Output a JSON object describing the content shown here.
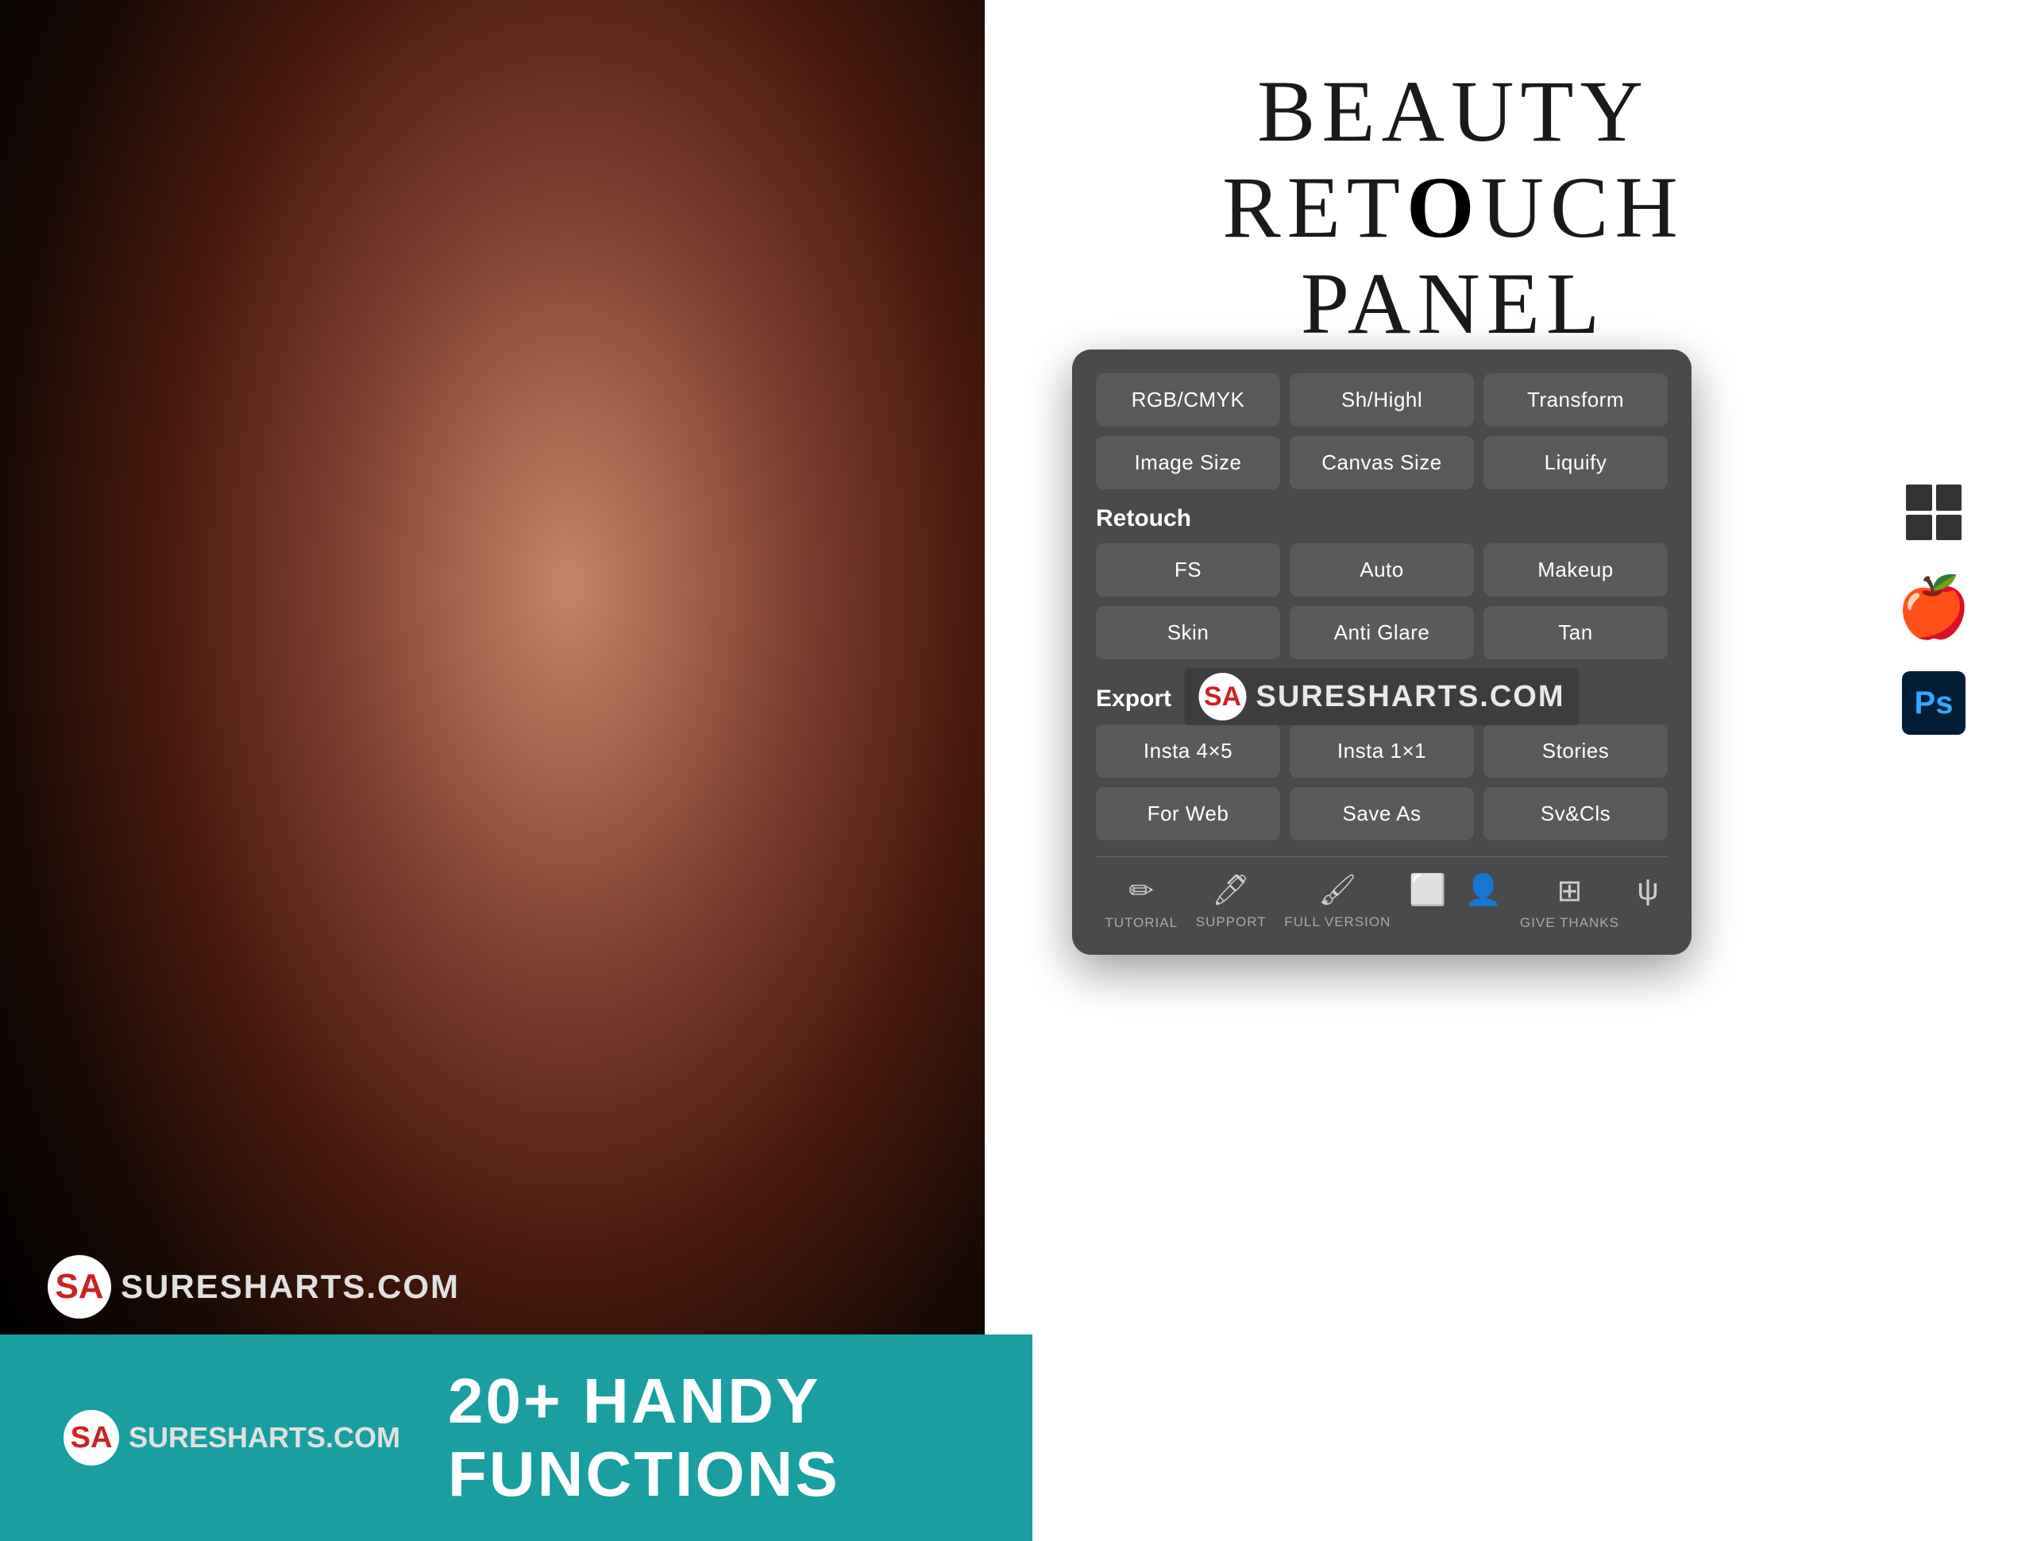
{
  "title": "Beauty Retouch Panel",
  "title_line1": "BEAUTY RET",
  "title_bold_o": "O",
  "title_line1_end": "UCH",
  "title_line2": "PANEL",
  "brand": {
    "name": "SURESHARTS.COM",
    "logo_letter": "SA"
  },
  "panel": {
    "top_buttons_row1": [
      {
        "label": "RGB/CMYK",
        "id": "rgb-cmyk"
      },
      {
        "label": "Sh/Highl",
        "id": "sh-highl"
      },
      {
        "label": "Transform",
        "id": "transform"
      }
    ],
    "top_buttons_row2": [
      {
        "label": "Image Size",
        "id": "image-size"
      },
      {
        "label": "Canvas Size",
        "id": "canvas-size"
      },
      {
        "label": "Liquify",
        "id": "liquify"
      }
    ],
    "retouch_label": "Retouch",
    "retouch_buttons_row1": [
      {
        "label": "FS",
        "id": "fs"
      },
      {
        "label": "Auto",
        "id": "auto"
      },
      {
        "label": "Makeup",
        "id": "makeup"
      }
    ],
    "retouch_buttons_row2": [
      {
        "label": "Skin",
        "id": "skin"
      },
      {
        "label": "Anti Glare",
        "id": "anti-glare"
      },
      {
        "label": "Tan",
        "id": "tan"
      }
    ],
    "export_label": "Export",
    "export_buttons_row1": [
      {
        "label": "Insta 4×5",
        "id": "insta-4x5"
      },
      {
        "label": "Insta 1×1",
        "id": "insta-1x1"
      },
      {
        "label": "Stories",
        "id": "stories"
      }
    ],
    "export_buttons_row2": [
      {
        "label": "For Web",
        "id": "for-web"
      },
      {
        "label": "Save As",
        "id": "save-as"
      },
      {
        "label": "Sv&Cls",
        "id": "sv-cls"
      }
    ],
    "toolbar": [
      {
        "icon": "✏️",
        "label": "TUTORIAL",
        "id": "tutorial"
      },
      {
        "icon": "🖊️",
        "label": "SUPPORT",
        "id": "support"
      },
      {
        "icon": "🖌️",
        "label": "FULL VERSION",
        "id": "full-version"
      },
      {
        "icon": "🔧",
        "label": "",
        "id": "tool4"
      },
      {
        "icon": "👤",
        "label": "",
        "id": "tool5"
      },
      {
        "icon": "➕",
        "label": "GIVE THANKS",
        "id": "give-thanks"
      },
      {
        "icon": "ψ",
        "label": "",
        "id": "tool7"
      }
    ]
  },
  "bottom_strip": {
    "tagline_number": "20+",
    "tagline_text": "HANDY FUNCTIONS"
  },
  "platforms": [
    "Windows",
    "macOS",
    "Photoshop"
  ]
}
